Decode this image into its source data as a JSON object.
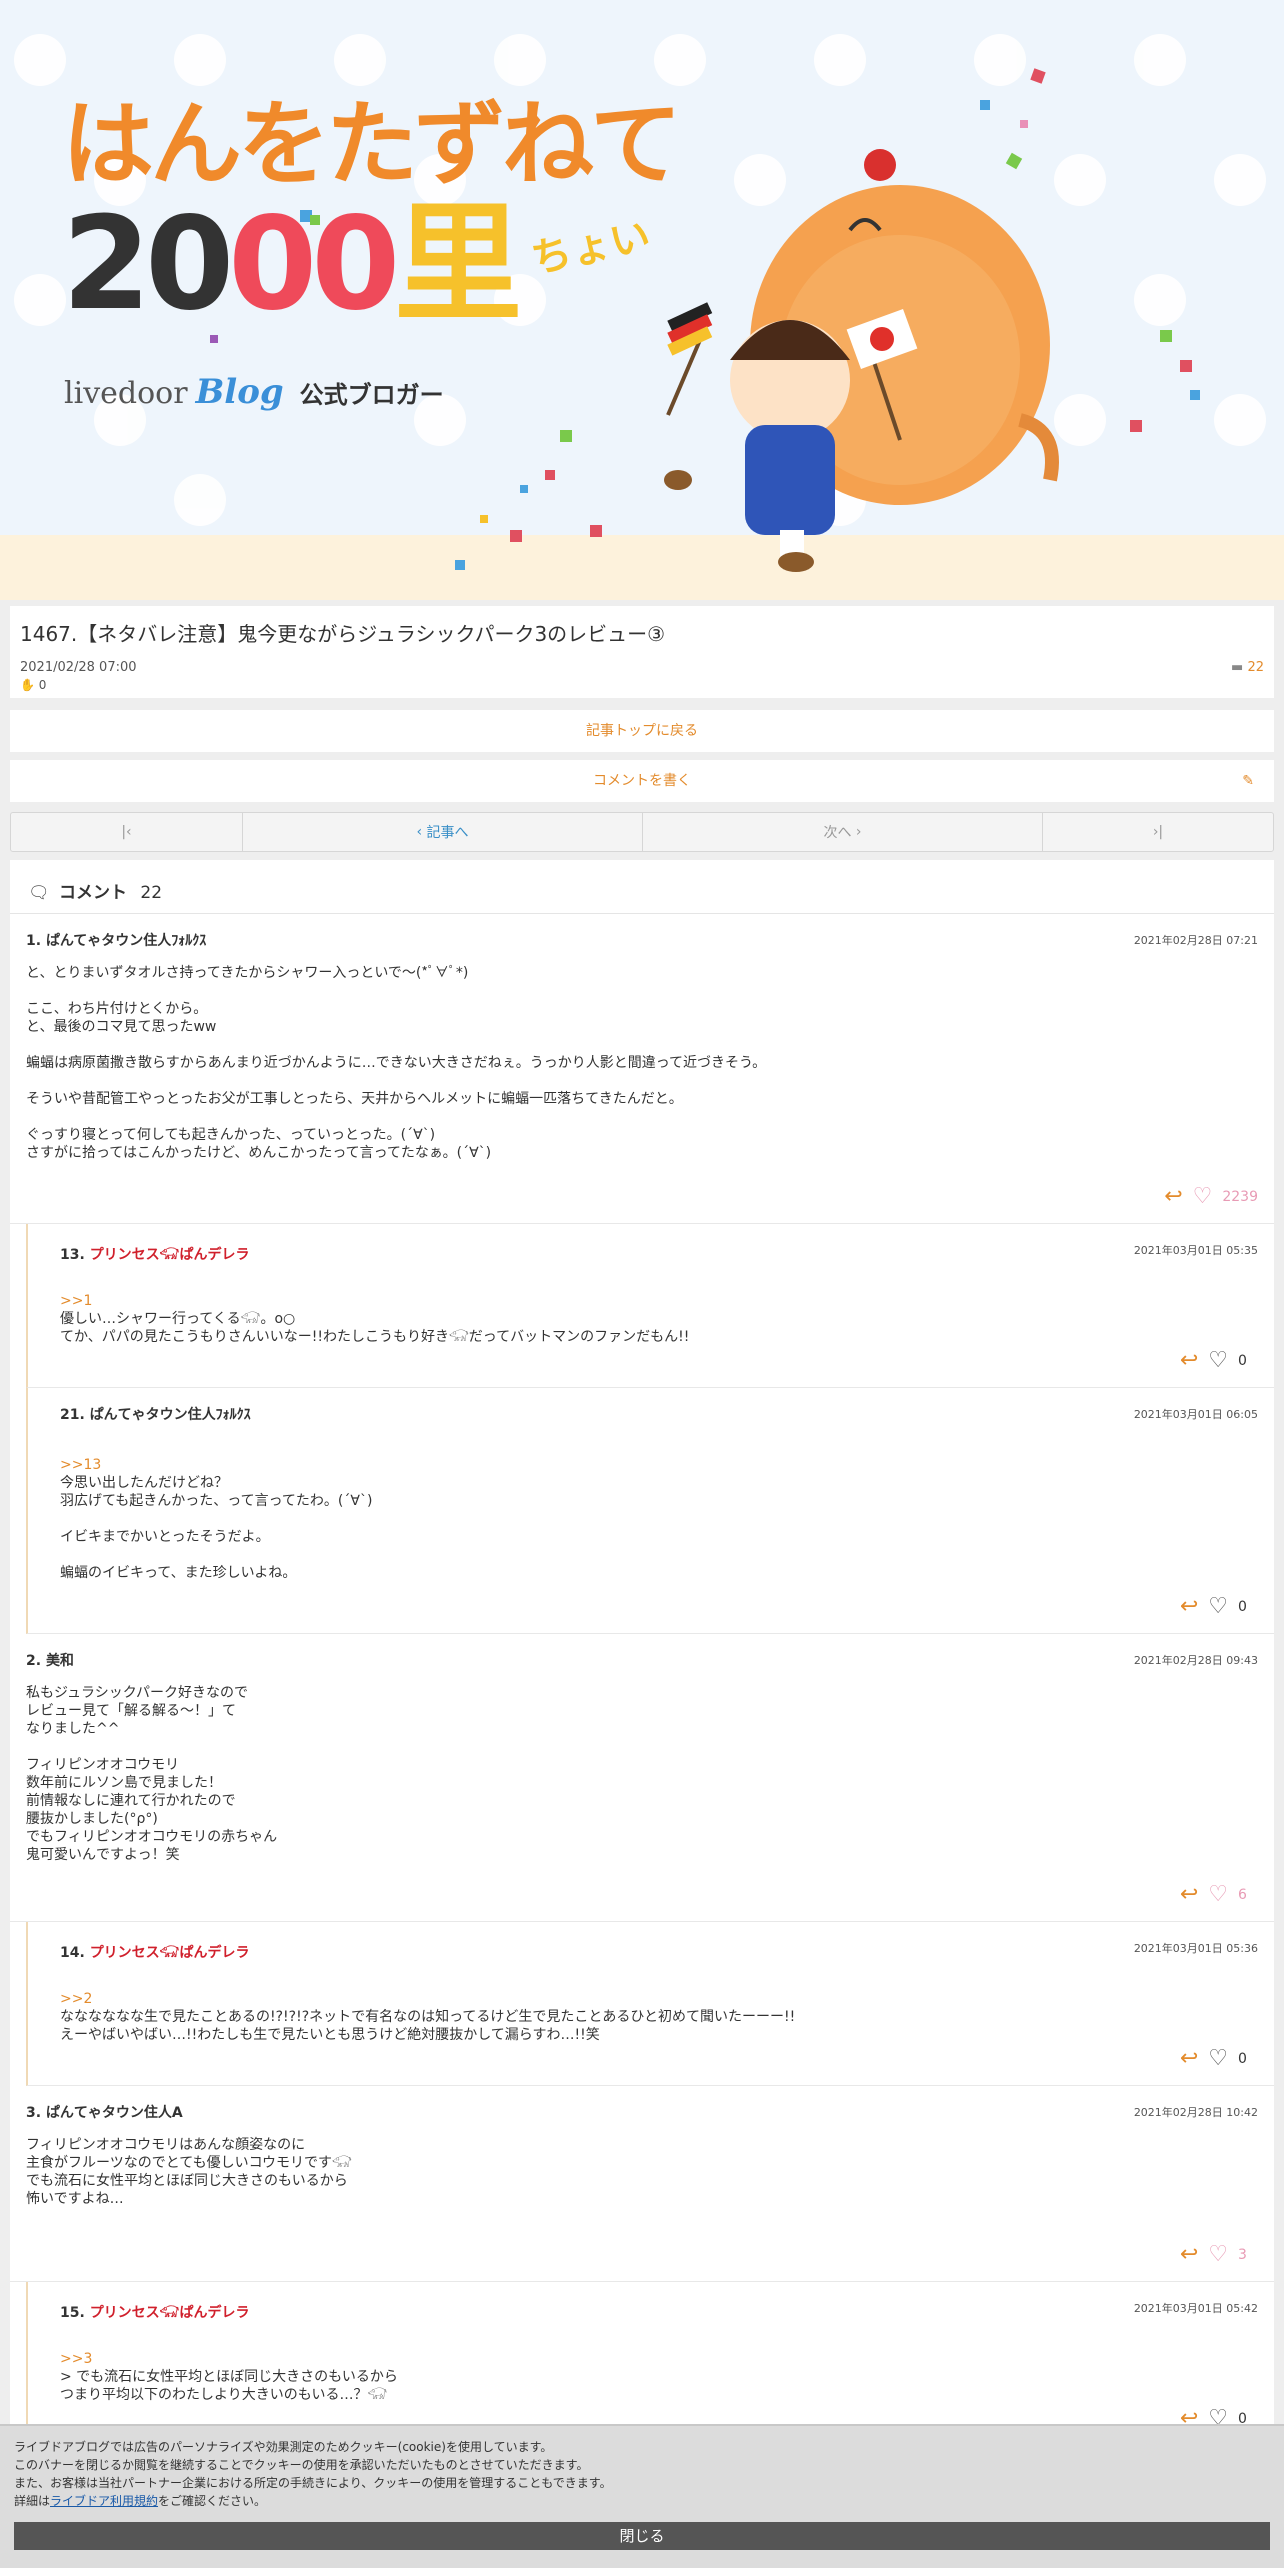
{
  "header": {
    "title_line1": "はんをたずねて",
    "title_line2a": "20",
    "title_line2b": "00",
    "title_line2c": "里",
    "title_small": "ちょい",
    "brand": "livedoor",
    "brand_blog": "Blog",
    "brand_tag": "公式ブロガー"
  },
  "article": {
    "title": "1467.【ネタバレ注意】鬼今更ながらジュラシックパーク3のレビュー③",
    "date": "2021/02/28 07:00",
    "likes": "0",
    "comment_count": "22"
  },
  "links": {
    "back_top": "記事トップに戻る",
    "write_comment": "コメントを書く"
  },
  "pager": {
    "prev": "記事へ",
    "next": "次へ"
  },
  "comments_header": {
    "label": "コメント",
    "count": "22"
  },
  "comments": [
    {
      "num": "1.",
      "author": "ぱんてゃタウン住人ﾌｫﾙｸｽ",
      "time": "2021年02月28日 07:21",
      "body": "と、とりまいずタオルさ持ってきたからシャワー入っといで～(*ﾟ∀ﾟ*)\n\nここ、わち片付けとくから。\nと、最後のコマ見て思ったww\n\n蝙蝠は病原菌撒き散らすからあんまり近づかんように…できない大きさだねぇ。うっかり人影と間違って近づきそう。\n\nそういや昔配管工やっとったお父が工事しとったら、天井からヘルメットに蝙蝠一匹落ちてきたんだと。\n\nぐっすり寝とって何しても起きんかった、っていっとった。(´∀`)\nさすがに拾ってはこんかったけど、めんこかったって言ってたなぁ。(´∀`)",
      "count": "2239"
    },
    {
      "num": "13.",
      "author": "プリンセス𓃟ぱんデレラ",
      "time": "2021年03月01日 05:35",
      "ref": ">>1",
      "body": "優しい…シャワー行ってくる𓃟。o○\nてか、パパの見たこうもりさんいいなー!!わたしこうもり好き𓃟だってバットマンのファンだもん!!",
      "count": "0"
    },
    {
      "num": "21.",
      "author": "ぱんてゃタウン住人ﾌｫﾙｸｽ",
      "time": "2021年03月01日 06:05",
      "ref": ">>13",
      "body": "今思い出したんだけどね？\n羽広げても起きんかった、って言ってたわ。(´∀`)\n\nイビキまでかいとったそうだよ。\n\n蝙蝠のイビキって、また珍しいよね。",
      "count": "0"
    },
    {
      "num": "2.",
      "author": "美和",
      "time": "2021年02月28日 09:43",
      "body": "私もジュラシックパーク好きなので\nレビュー見て「解る解る〜！」て\nなりました^^\n\nフィリピンオオコウモリ\n数年前にルソン島で見ました！\n前情報なしに連れて行かれたので\n腰抜かしました(°ρ°)\nでもフィリピンオオコウモリの赤ちゃん\n鬼可愛いんですよっ！笑",
      "count": "6"
    },
    {
      "num": "14.",
      "author": "プリンセス𓃟ぱんデレラ",
      "time": "2021年03月01日 05:36",
      "ref": ">>2",
      "body": "なななななな生で見たことあるの!?!?!?ネットで有名なのは知ってるけど生で見たことあるひと初めて聞いたーーー!!\nえーやばいやばい…!!わたしも生で見たいとも思うけど絶対腰抜かして漏らすわ…!!笑",
      "count": "0"
    },
    {
      "num": "3.",
      "author": "ぱんてゃタウン住人A",
      "time": "2021年02月28日 10:42",
      "body": "フィリピンオオコウモリはあんな顔姿なのに\n主食がフルーツなのでとても優しいコウモリです𓃟\nでも流石に女性平均とほぼ同じ大きさのもいるから\n怖いですよね…",
      "count": "3"
    },
    {
      "num": "15.",
      "author": "プリンセス𓃟ぱんデレラ",
      "time": "2021年03月01日 05:42",
      "ref": ">>3",
      "body": "> でも流石に女性平均とほぼ同じ大きさのもいるから\nつまり平均以下のわたしより大きいのもいる…？𓃟",
      "count": "0"
    }
  ],
  "cookie": {
    "line1": "ライブドアブログでは広告のパーソナライズや効果測定のためクッキー(cookie)を使用しています。",
    "line2": "このバナーを閉じるか閲覧を継続することでクッキーの使用を承認いただいたものとさせていただきます。",
    "line3": "また、お客様は当社パートナー企業における所定の手続きにより、クッキーの使用を管理することもできます。",
    "line4_pre": "詳細は",
    "line4_link": "ライブドア利用規約",
    "line4_post": "をご確認ください。",
    "close": "閉じる"
  },
  "colors": {
    "accent": "#e38b2c",
    "red_author": "#d0202c",
    "pink_heart": "#e89bb5",
    "pager_link": "#3a8fc7"
  }
}
